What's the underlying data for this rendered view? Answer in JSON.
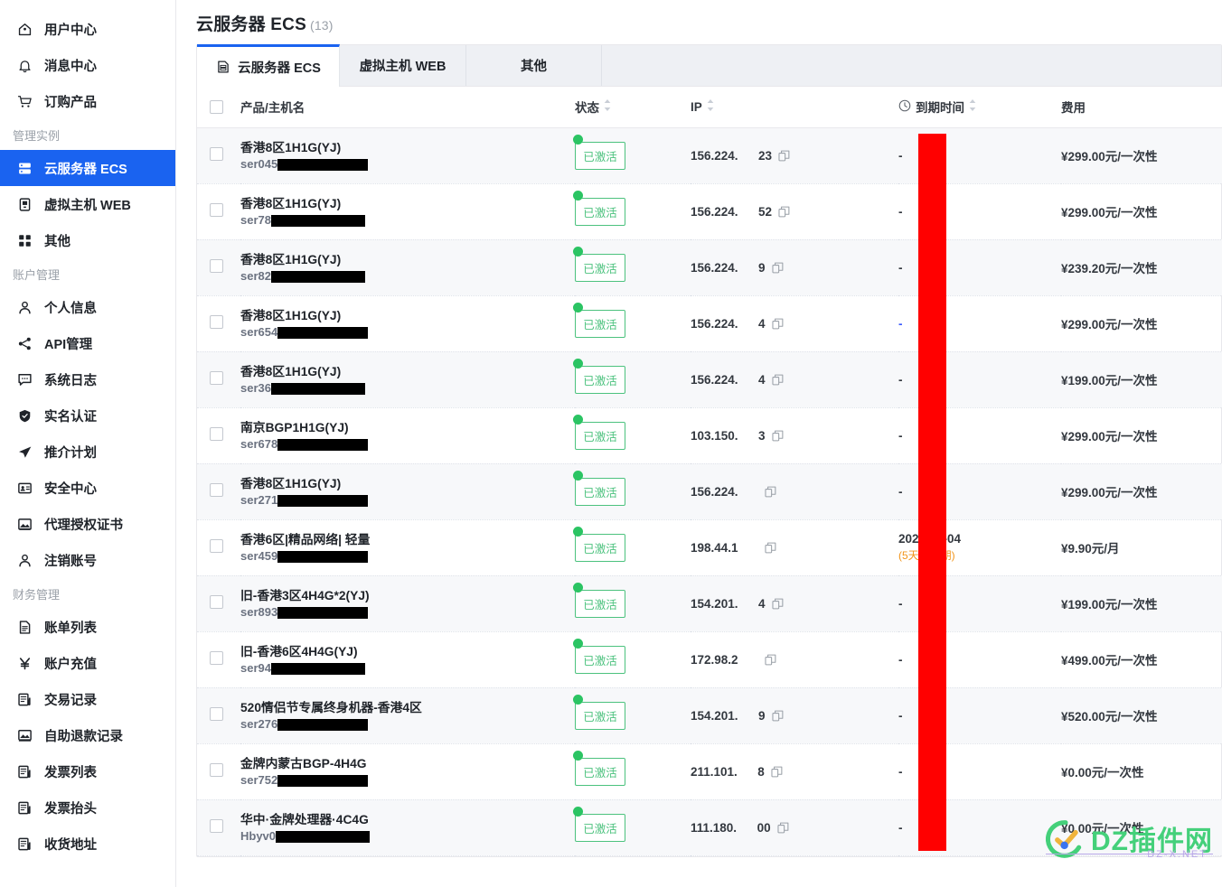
{
  "sidebar": {
    "items": [
      {
        "label": "用户中心",
        "icon": "home-icon",
        "type": "item",
        "active": false
      },
      {
        "label": "消息中心",
        "icon": "bell-icon",
        "type": "item",
        "active": false
      },
      {
        "label": "订购产品",
        "icon": "cart-icon",
        "type": "item",
        "active": false
      },
      {
        "label": "管理实例",
        "icon": "",
        "type": "group"
      },
      {
        "label": "云服务器 ECS",
        "icon": "server-icon",
        "type": "item",
        "active": true
      },
      {
        "label": "虚拟主机 WEB",
        "icon": "host-icon",
        "type": "item",
        "active": false
      },
      {
        "label": "其他",
        "icon": "grid-icon",
        "type": "item",
        "active": false
      },
      {
        "label": "账户管理",
        "icon": "",
        "type": "group"
      },
      {
        "label": "个人信息",
        "icon": "user-icon",
        "type": "item",
        "active": false
      },
      {
        "label": "API管理",
        "icon": "share-icon",
        "type": "item",
        "active": false
      },
      {
        "label": "系统日志",
        "icon": "chat-icon",
        "type": "item",
        "active": false
      },
      {
        "label": "实名认证",
        "icon": "shield-icon",
        "type": "item",
        "active": false
      },
      {
        "label": "推介计划",
        "icon": "send-icon",
        "type": "item",
        "active": false
      },
      {
        "label": "安全中心",
        "icon": "idcard-icon",
        "type": "item",
        "active": false
      },
      {
        "label": "代理授权证书",
        "icon": "certificate-icon",
        "type": "item",
        "active": false
      },
      {
        "label": "注销账号",
        "icon": "user-icon",
        "type": "item",
        "active": false
      },
      {
        "label": "财务管理",
        "icon": "",
        "type": "group"
      },
      {
        "label": "账单列表",
        "icon": "document-icon",
        "type": "item",
        "active": false
      },
      {
        "label": "账户充值",
        "icon": "yuan-icon",
        "type": "item",
        "active": false
      },
      {
        "label": "交易记录",
        "icon": "records-icon",
        "type": "item",
        "active": false
      },
      {
        "label": "自助退款记录",
        "icon": "refund-icon",
        "type": "item",
        "active": false
      },
      {
        "label": "发票列表",
        "icon": "records-icon",
        "type": "item",
        "active": false
      },
      {
        "label": "发票抬头",
        "icon": "records-icon",
        "type": "item",
        "active": false
      },
      {
        "label": "收货地址",
        "icon": "records-icon",
        "type": "item",
        "active": false
      }
    ]
  },
  "page": {
    "title": "云服务器 ECS",
    "count": "(13)"
  },
  "tabs": [
    {
      "label": "云服务器 ECS",
      "icon": "server-doc-icon",
      "active": true
    },
    {
      "label": "虚拟主机 WEB",
      "icon": "",
      "active": false
    },
    {
      "label": "其他",
      "icon": "",
      "active": false
    }
  ],
  "table": {
    "columns": {
      "name": "产品/主机名",
      "state": "状态",
      "ip": "IP",
      "expiry": "到期时间",
      "fee": "费用"
    },
    "rows": [
      {
        "product": "香港8区1H1G(YJ)",
        "host_prefix": "ser045",
        "mask_w": 100,
        "status": "已激活",
        "ip_prefix": "156.224.",
        "ip_suffix": "23",
        "expiry": "-",
        "expiry_sub": "",
        "expiry_blue": false,
        "fee": "¥299.00元/一次性"
      },
      {
        "product": "香港8区1H1G(YJ)",
        "host_prefix": "ser78",
        "mask_w": 104,
        "status": "已激活",
        "ip_prefix": "156.224.",
        "ip_suffix": "52",
        "expiry": "-",
        "expiry_sub": "",
        "expiry_blue": false,
        "fee": "¥299.00元/一次性"
      },
      {
        "product": "香港8区1H1G(YJ)",
        "host_prefix": "ser82",
        "mask_w": 104,
        "status": "已激活",
        "ip_prefix": "156.224.",
        "ip_suffix": "9",
        "expiry": "-",
        "expiry_sub": "",
        "expiry_blue": false,
        "fee": "¥239.20元/一次性"
      },
      {
        "product": "香港8区1H1G(YJ)",
        "host_prefix": "ser654",
        "mask_w": 100,
        "status": "已激活",
        "ip_prefix": "156.224.",
        "ip_suffix": "4",
        "expiry": "-",
        "expiry_sub": "",
        "expiry_blue": true,
        "fee": "¥299.00元/一次性"
      },
      {
        "product": "香港8区1H1G(YJ)",
        "host_prefix": "ser36",
        "mask_w": 104,
        "status": "已激活",
        "ip_prefix": "156.224.",
        "ip_suffix": "4",
        "expiry": "-",
        "expiry_sub": "",
        "expiry_blue": false,
        "fee": "¥199.00元/一次性"
      },
      {
        "product": "南京BGP1H1G(YJ)",
        "host_prefix": "ser678",
        "mask_w": 100,
        "status": "已激活",
        "ip_prefix": "103.150.",
        "ip_suffix": "3",
        "expiry": "-",
        "expiry_sub": "",
        "expiry_blue": false,
        "fee": "¥299.00元/一次性"
      },
      {
        "product": "香港8区1H1G(YJ)",
        "host_prefix": "ser271",
        "mask_w": 100,
        "status": "已激活",
        "ip_prefix": "156.224.",
        "ip_suffix": "",
        "expiry": "-",
        "expiry_sub": "",
        "expiry_blue": false,
        "fee": "¥299.00元/一次性"
      },
      {
        "product": "香港6区|精品网络| 轻量",
        "host_prefix": "ser459",
        "mask_w": 100,
        "status": "已激活",
        "ip_prefix": "198.44.1",
        "ip_suffix": "",
        "expiry": "2024-10-04",
        "expiry_sub": "(5天后到期)",
        "expiry_blue": false,
        "fee": "¥9.90元/月"
      },
      {
        "product": "旧-香港3区4H4G*2(YJ)",
        "host_prefix": "ser893",
        "mask_w": 100,
        "status": "已激活",
        "ip_prefix": "154.201.",
        "ip_suffix": "4",
        "expiry": "-",
        "expiry_sub": "",
        "expiry_blue": false,
        "fee": "¥199.00元/一次性"
      },
      {
        "product": "旧-香港6区4H4G(YJ)",
        "host_prefix": "ser94",
        "mask_w": 104,
        "status": "已激活",
        "ip_prefix": "172.98.2",
        "ip_suffix": "",
        "expiry": "-",
        "expiry_sub": "",
        "expiry_blue": false,
        "fee": "¥499.00元/一次性"
      },
      {
        "product": "520情侣节专属终身机器-香港4区",
        "host_prefix": "ser276",
        "mask_w": 100,
        "status": "已激活",
        "ip_prefix": "154.201.",
        "ip_suffix": "9",
        "expiry": "-",
        "expiry_sub": "",
        "expiry_blue": false,
        "fee": "¥520.00元/一次性"
      },
      {
        "product": "金牌内蒙古BGP-4H4G",
        "host_prefix": "ser752",
        "mask_w": 100,
        "status": "已激活",
        "ip_prefix": "211.101.",
        "ip_suffix": "8",
        "expiry": "-",
        "expiry_sub": "",
        "expiry_blue": false,
        "fee": "¥0.00元/一次性"
      },
      {
        "product": "华中·金牌处理器·4C4G",
        "host_prefix": "Hbyv0",
        "mask_w": 104,
        "status": "已激活",
        "ip_prefix": "111.180.",
        "ip_suffix": "00",
        "expiry": "-",
        "expiry_sub": "",
        "expiry_blue": false,
        "fee": "¥0.00元/一次性"
      }
    ]
  },
  "watermark": {
    "text": "DZ插件网",
    "sub": "DZ-X.NET"
  },
  "colors": {
    "accent": "#1a63f0",
    "status_green": "#4cc27e",
    "dot_green": "#2bc463",
    "warn_orange": "#f2951c",
    "redaction_red": "#ff0000"
  }
}
